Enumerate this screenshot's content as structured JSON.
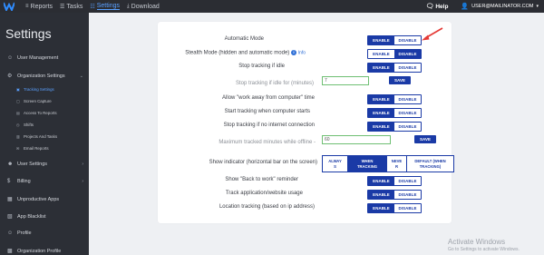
{
  "topbar": {
    "nav": [
      {
        "label": "Reports",
        "icon": "chart-icon",
        "active": false
      },
      {
        "label": "Tasks",
        "icon": "list-icon",
        "active": false
      },
      {
        "label": "Settings",
        "icon": "sliders-icon",
        "active": true
      },
      {
        "label": "Download",
        "icon": "download-icon",
        "active": false
      }
    ],
    "help_label": "Help",
    "user_email": "USER@MAILINATOR.COM"
  },
  "sidebar": {
    "title": "Settings",
    "items": [
      {
        "label": "User Management",
        "icon": "user-icon"
      },
      {
        "label": "Organization Settings",
        "icon": "gear-icon",
        "caret": "chevron-down-icon"
      },
      {
        "label": "User Settings",
        "icon": "user-gear-icon",
        "caret": "chevron-right-icon"
      },
      {
        "label": "Billing",
        "icon": "dollar-icon",
        "caret": "chevron-right-icon"
      },
      {
        "label": "Unproductive Apps",
        "icon": "app-icon"
      },
      {
        "label": "App Blacklist",
        "icon": "blacklist-icon"
      },
      {
        "label": "Profile",
        "icon": "profile-icon"
      },
      {
        "label": "Organization Profile",
        "icon": "building-icon"
      }
    ],
    "subitems": [
      {
        "label": "Tracking Settings",
        "active": true
      },
      {
        "label": "Screen Capture",
        "active": false
      },
      {
        "label": "Access To Reports",
        "active": false
      },
      {
        "label": "Shifts",
        "active": false
      },
      {
        "label": "Projects And Tasks",
        "active": false
      },
      {
        "label": "Email Reports",
        "active": false
      }
    ]
  },
  "settings": {
    "automatic_mode": {
      "label": "Automatic Mode",
      "enable": "ENABLE",
      "disable": "DISABLE",
      "selected": "enable"
    },
    "stealth_mode": {
      "label": "Stealth Mode (hidden and automatic mode)",
      "info": "Info",
      "enable": "ENABLE",
      "disable": "DISABLE",
      "selected": "disable"
    },
    "stop_idle": {
      "label": "Stop tracking if idle",
      "enable": "ENABLE",
      "disable": "DISABLE",
      "selected": "enable"
    },
    "idle_minutes": {
      "label": "Stop tracking if idle for (minutes)",
      "value": "7",
      "save": "SAVE"
    },
    "away_time": {
      "label": "Allow \"work away from computer\" time",
      "enable": "ENABLE",
      "disable": "DISABLE",
      "selected": "enable"
    },
    "start_computer": {
      "label": "Start tracking when computer starts",
      "enable": "ENABLE",
      "disable": "DISABLE",
      "selected": "enable"
    },
    "stop_internet": {
      "label": "Stop tracking if no internet connection",
      "enable": "ENABLE",
      "disable": "DISABLE",
      "selected": "enable"
    },
    "max_offline": {
      "label": "Maximum tracked minutes while offline -",
      "value": "60",
      "save": "SAVE"
    },
    "indicator": {
      "label": "Show indicator (horizontal bar on the screen)",
      "options": [
        {
          "line1": "ALWAY",
          "line2": "S",
          "selected": false
        },
        {
          "line1": "WHEN",
          "line2": "TRACKING",
          "selected": true
        },
        {
          "line1": "NEVE",
          "line2": "R",
          "selected": false
        },
        {
          "line1": "DEFAULT (WHEN",
          "line2": "TRACKING)",
          "selected": false
        }
      ]
    },
    "back_to_work": {
      "label": "Show \"Back to work\" reminder",
      "enable": "ENABLE",
      "disable": "DISABLE",
      "selected": "enable"
    },
    "app_usage": {
      "label": "Track application/website usage",
      "enable": "ENABLE",
      "disable": "DISABLE",
      "selected": "enable"
    },
    "location": {
      "label": "Location tracking (based on ip address)",
      "enable": "ENABLE",
      "disable": "DISABLE",
      "selected": "enable"
    }
  },
  "watermark": {
    "line1": "Activate Windows",
    "line2": "Go to Settings to activate Windows."
  },
  "colors": {
    "accent": "#1a3aa6",
    "topbar": "#2b2d33",
    "sidebar": "#2c2f36",
    "active_link": "#5aa0ff",
    "arrow": "#e53935"
  }
}
